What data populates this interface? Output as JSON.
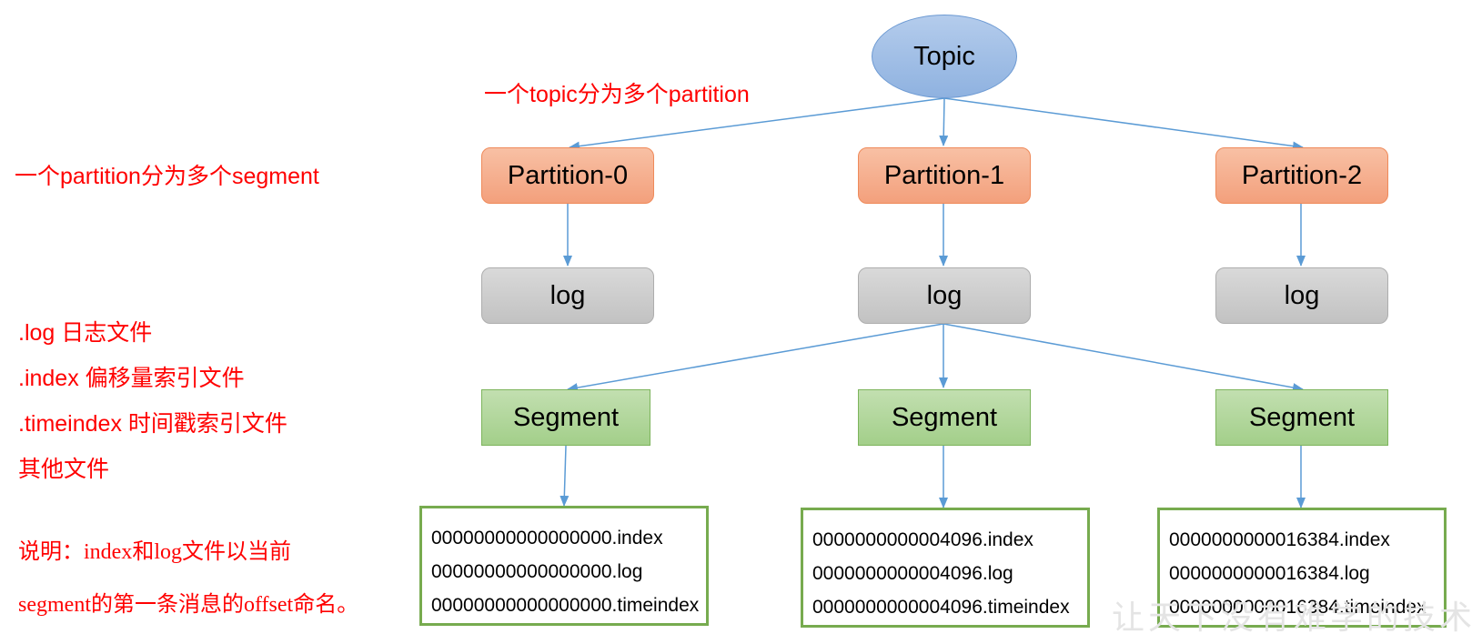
{
  "colors": {
    "annotation": "#ff0000",
    "arrow": "#5b9bd5",
    "topic_fill": "#9dbde6",
    "partition_fill": "#f5ae8c",
    "log_fill": "#cccccc",
    "segment_fill": "#b0d79b",
    "files_border": "#77ab4f"
  },
  "annotations": {
    "topic_to_partition": "一个topic分为多个partition",
    "partition_to_segment": "一个partition分为多个segment",
    "file_types": [
      ".log  日志文件",
      ".index 偏移量索引文件",
      ".timeindex 时间戳索引文件",
      "其他文件"
    ],
    "explanation": [
      "说明：index和log文件以当前",
      "segment的第一条消息的offset命名。"
    ]
  },
  "topic": {
    "label": "Topic"
  },
  "partitions": [
    {
      "label": "Partition-0",
      "log": "log",
      "segment": "Segment",
      "files": [
        "00000000000000000.index",
        "00000000000000000.log",
        "00000000000000000.timeindex"
      ]
    },
    {
      "label": "Partition-1",
      "log": "log",
      "segment": "Segment",
      "files": [
        "0000000000004096.index",
        "0000000000004096.log",
        "0000000000004096.timeindex"
      ]
    },
    {
      "label": "Partition-2",
      "log": "log",
      "segment": "Segment",
      "files": [
        "0000000000016384.index",
        "0000000000016384.log",
        "0000000000016384.timeindex"
      ]
    }
  ],
  "watermark": "让天下没有难学的技术"
}
